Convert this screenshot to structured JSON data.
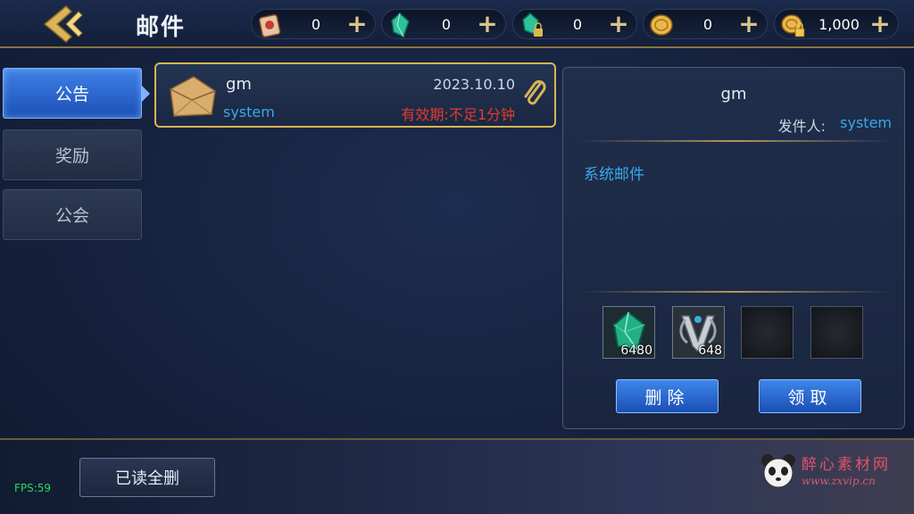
{
  "header": {
    "title": "邮件",
    "resources": [
      {
        "icon": "scroll-ticket-icon",
        "value": "0"
      },
      {
        "icon": "green-gem-icon",
        "value": "0"
      },
      {
        "icon": "locked-green-gem-icon",
        "value": "0"
      },
      {
        "icon": "gold-coin-icon",
        "value": "0"
      },
      {
        "icon": "locked-gold-coin-icon",
        "value": "1,000"
      }
    ],
    "plus_label": "+"
  },
  "tabs": [
    {
      "label": "公告",
      "active": true
    },
    {
      "label": "奖励",
      "active": false
    },
    {
      "label": "公会",
      "active": false
    }
  ],
  "mail_list": [
    {
      "sender": "gm",
      "date": "2023.10.10",
      "origin": "system",
      "expiry": "有效期:不足1分钟",
      "has_attachment": true
    }
  ],
  "detail": {
    "title": "gm",
    "from_label": "发件人:",
    "from_value": "system",
    "body": "系统邮件",
    "attachments": [
      {
        "icon": "green-gem-icon",
        "qty": "6480"
      },
      {
        "icon": "silver-emblem-icon",
        "qty": "648"
      },
      {
        "icon": "",
        "qty": ""
      },
      {
        "icon": "",
        "qty": ""
      }
    ],
    "delete_label": "删除",
    "claim_label": "领取"
  },
  "footer": {
    "delete_all_label": "已读全删",
    "fps": "FPS:59"
  },
  "watermark": {
    "line1": "醉心素材网",
    "line2": "www.zxvip.cn"
  },
  "colors": {
    "accent_blue": "#39a9ea",
    "expiry_red": "#e53a2e",
    "gold_border": "#d7b457",
    "button_blue": "#2a6ad0"
  }
}
